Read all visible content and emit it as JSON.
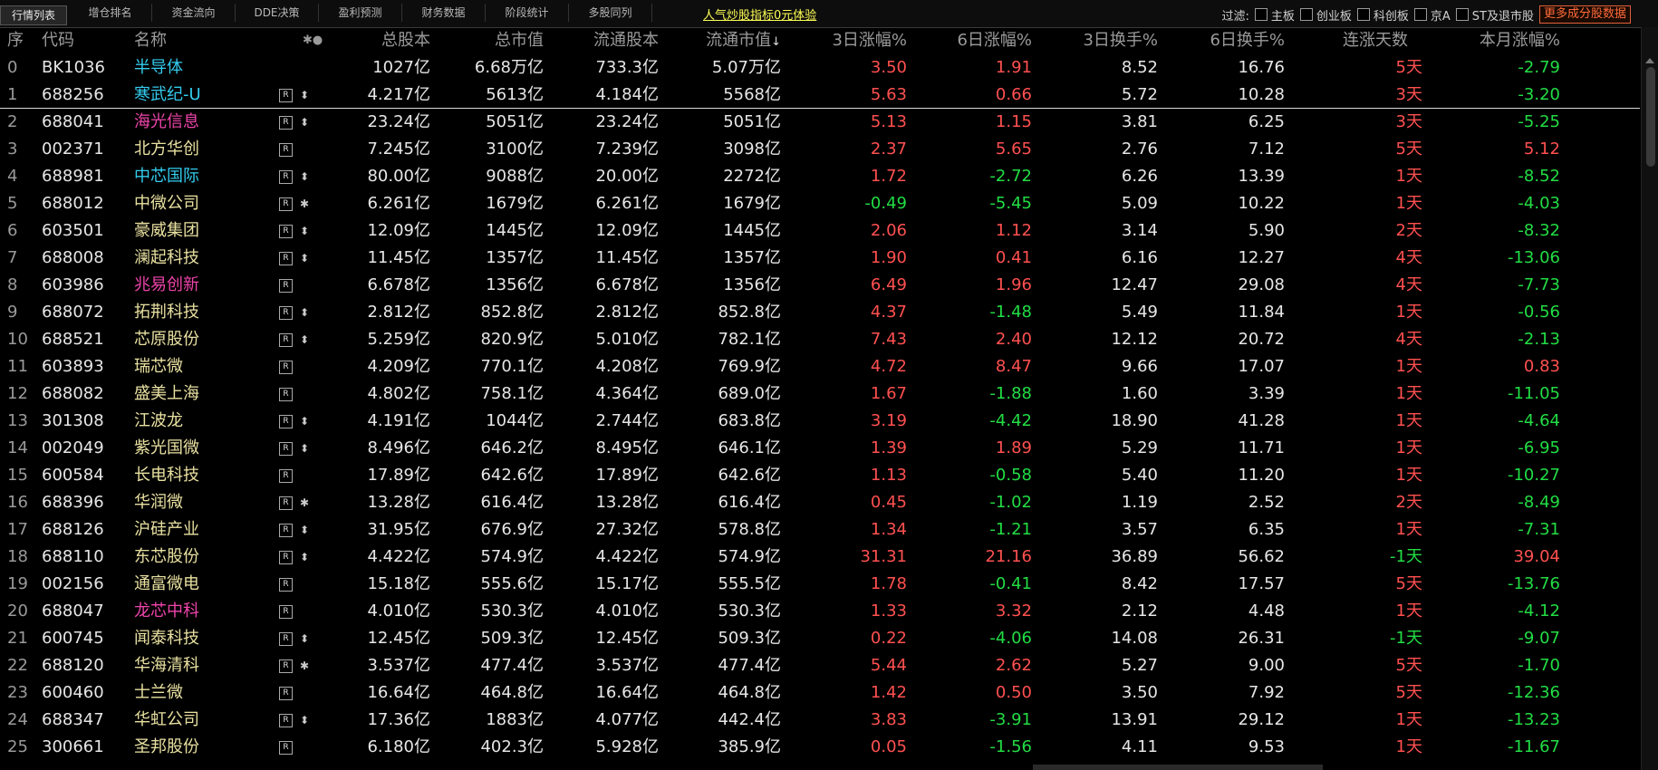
{
  "tabs": [
    "行情列表",
    "增仓排名",
    "资金流向",
    "DDE决策",
    "盈利预测",
    "财务数据",
    "阶段统计",
    "多股同列"
  ],
  "promo_text": "人气炒股指标0元体验",
  "filter": {
    "label": "过滤:",
    "options": [
      "主板",
      "创业板",
      "科创板",
      "京A",
      "ST及退市股"
    ],
    "more_label": "更多成分股数据"
  },
  "headers": {
    "idx": "序",
    "code": "代码",
    "name": "名称",
    "marks": "✱●",
    "zgb": "总股本",
    "zsz": "总市值",
    "ltgb": "流通股本",
    "ltsz": "流通市值",
    "zf3": "3日涨幅%",
    "zf6": "6日涨幅%",
    "hs3": "3日换手%",
    "hs6": "6日换手%",
    "days": "连涨天数",
    "mon": "本月涨幅%"
  },
  "colors": {
    "up": "#ff5050",
    "down": "#22dd44",
    "name_cyan": "#33ccee",
    "name_magenta": "#ee44aa",
    "name_yellow": "#e8e0a0"
  },
  "rows": [
    {
      "idx": "0",
      "code": "BK1036",
      "name": "半导体",
      "name_color": "#33ccee",
      "r": false,
      "mark": "",
      "zgb": "1027亿",
      "zsz": "6.68万亿",
      "ltgb": "733.3亿",
      "ltsz": "5.07万亿",
      "zf3": "3.50",
      "zf6": "1.91",
      "hs3": "8.52",
      "hs6": "16.76",
      "days": "5天",
      "mon": "-2.79"
    },
    {
      "idx": "1",
      "code": "688256",
      "name": "寒武纪-U",
      "name_color": "#33ccee",
      "r": true,
      "mark": "⬍",
      "zgb": "4.217亿",
      "zsz": "5613亿",
      "ltgb": "4.184亿",
      "ltsz": "5568亿",
      "zf3": "5.63",
      "zf6": "0.66",
      "hs3": "5.72",
      "hs6": "10.28",
      "days": "3天",
      "mon": "-3.20"
    },
    {
      "idx": "2",
      "code": "688041",
      "name": "海光信息",
      "name_color": "#ee44aa",
      "r": true,
      "mark": "⬍",
      "zgb": "23.24亿",
      "zsz": "5051亿",
      "ltgb": "23.24亿",
      "ltsz": "5051亿",
      "zf3": "5.13",
      "zf6": "1.15",
      "hs3": "3.81",
      "hs6": "6.25",
      "days": "3天",
      "mon": "-5.25"
    },
    {
      "idx": "3",
      "code": "002371",
      "name": "北方华创",
      "name_color": "#e8e0a0",
      "r": true,
      "mark": "",
      "zgb": "7.245亿",
      "zsz": "3100亿",
      "ltgb": "7.239亿",
      "ltsz": "3098亿",
      "zf3": "2.37",
      "zf6": "5.65",
      "hs3": "2.76",
      "hs6": "7.12",
      "days": "5天",
      "mon": "5.12"
    },
    {
      "idx": "4",
      "code": "688981",
      "name": "中芯国际",
      "name_color": "#33ccee",
      "r": true,
      "mark": "⬍",
      "zgb": "80.00亿",
      "zsz": "9088亿",
      "ltgb": "20.00亿",
      "ltsz": "2272亿",
      "zf3": "1.72",
      "zf6": "-2.72",
      "hs3": "6.26",
      "hs6": "13.39",
      "days": "1天",
      "mon": "-8.52"
    },
    {
      "idx": "5",
      "code": "688012",
      "name": "中微公司",
      "name_color": "#e8e0a0",
      "r": true,
      "mark": "✱",
      "zgb": "6.261亿",
      "zsz": "1679亿",
      "ltgb": "6.261亿",
      "ltsz": "1679亿",
      "zf3": "-0.49",
      "zf6": "-5.45",
      "hs3": "5.09",
      "hs6": "10.22",
      "days": "1天",
      "mon": "-4.03"
    },
    {
      "idx": "6",
      "code": "603501",
      "name": "豪威集团",
      "name_color": "#e8e0a0",
      "r": true,
      "mark": "⬍",
      "zgb": "12.09亿",
      "zsz": "1445亿",
      "ltgb": "12.09亿",
      "ltsz": "1445亿",
      "zf3": "2.06",
      "zf6": "1.12",
      "hs3": "3.14",
      "hs6": "5.90",
      "days": "2天",
      "mon": "-8.32"
    },
    {
      "idx": "7",
      "code": "688008",
      "name": "澜起科技",
      "name_color": "#e8e0a0",
      "r": true,
      "mark": "⬍",
      "zgb": "11.45亿",
      "zsz": "1357亿",
      "ltgb": "11.45亿",
      "ltsz": "1357亿",
      "zf3": "1.90",
      "zf6": "0.41",
      "hs3": "6.16",
      "hs6": "12.27",
      "days": "4天",
      "mon": "-13.06"
    },
    {
      "idx": "8",
      "code": "603986",
      "name": "兆易创新",
      "name_color": "#ee44aa",
      "r": true,
      "mark": "",
      "zgb": "6.678亿",
      "zsz": "1356亿",
      "ltgb": "6.678亿",
      "ltsz": "1356亿",
      "zf3": "6.49",
      "zf6": "1.96",
      "hs3": "12.47",
      "hs6": "29.08",
      "days": "4天",
      "mon": "-7.73"
    },
    {
      "idx": "9",
      "code": "688072",
      "name": "拓荆科技",
      "name_color": "#e8e0a0",
      "r": true,
      "mark": "⬍",
      "zgb": "2.812亿",
      "zsz": "852.8亿",
      "ltgb": "2.812亿",
      "ltsz": "852.8亿",
      "zf3": "4.37",
      "zf6": "-1.48",
      "hs3": "5.49",
      "hs6": "11.84",
      "days": "1天",
      "mon": "-0.56"
    },
    {
      "idx": "10",
      "code": "688521",
      "name": "芯原股份",
      "name_color": "#e8e0a0",
      "r": true,
      "mark": "⬍",
      "zgb": "5.259亿",
      "zsz": "820.9亿",
      "ltgb": "5.010亿",
      "ltsz": "782.1亿",
      "zf3": "7.43",
      "zf6": "2.40",
      "hs3": "12.12",
      "hs6": "20.72",
      "days": "4天",
      "mon": "-2.13"
    },
    {
      "idx": "11",
      "code": "603893",
      "name": "瑞芯微",
      "name_color": "#e8e0a0",
      "r": true,
      "mark": "",
      "zgb": "4.209亿",
      "zsz": "770.1亿",
      "ltgb": "4.208亿",
      "ltsz": "769.9亿",
      "zf3": "4.72",
      "zf6": "8.47",
      "hs3": "9.66",
      "hs6": "17.07",
      "days": "1天",
      "mon": "0.83"
    },
    {
      "idx": "12",
      "code": "688082",
      "name": "盛美上海",
      "name_color": "#e8e0a0",
      "r": true,
      "mark": "",
      "zgb": "4.802亿",
      "zsz": "758.1亿",
      "ltgb": "4.364亿",
      "ltsz": "689.0亿",
      "zf3": "1.67",
      "zf6": "-1.88",
      "hs3": "1.60",
      "hs6": "3.39",
      "days": "1天",
      "mon": "-11.05"
    },
    {
      "idx": "13",
      "code": "301308",
      "name": "江波龙",
      "name_color": "#e8e0a0",
      "r": true,
      "mark": "⬍",
      "zgb": "4.191亿",
      "zsz": "1044亿",
      "ltgb": "2.744亿",
      "ltsz": "683.8亿",
      "zf3": "3.19",
      "zf6": "-4.42",
      "hs3": "18.90",
      "hs6": "41.28",
      "days": "1天",
      "mon": "-4.64"
    },
    {
      "idx": "14",
      "code": "002049",
      "name": "紫光国微",
      "name_color": "#e8e0a0",
      "r": true,
      "mark": "⬍",
      "zgb": "8.496亿",
      "zsz": "646.2亿",
      "ltgb": "8.495亿",
      "ltsz": "646.1亿",
      "zf3": "1.39",
      "zf6": "1.89",
      "hs3": "5.29",
      "hs6": "11.71",
      "days": "1天",
      "mon": "-6.95"
    },
    {
      "idx": "15",
      "code": "600584",
      "name": "长电科技",
      "name_color": "#e8e0a0",
      "r": true,
      "mark": "",
      "zgb": "17.89亿",
      "zsz": "642.6亿",
      "ltgb": "17.89亿",
      "ltsz": "642.6亿",
      "zf3": "1.13",
      "zf6": "-0.58",
      "hs3": "5.40",
      "hs6": "11.20",
      "days": "1天",
      "mon": "-10.27"
    },
    {
      "idx": "16",
      "code": "688396",
      "name": "华润微",
      "name_color": "#e8e0a0",
      "r": true,
      "mark": "✱",
      "zgb": "13.28亿",
      "zsz": "616.4亿",
      "ltgb": "13.28亿",
      "ltsz": "616.4亿",
      "zf3": "0.45",
      "zf6": "-1.02",
      "hs3": "1.19",
      "hs6": "2.52",
      "days": "2天",
      "mon": "-8.49"
    },
    {
      "idx": "17",
      "code": "688126",
      "name": "沪硅产业",
      "name_color": "#e8e0a0",
      "r": true,
      "mark": "⬍",
      "zgb": "31.95亿",
      "zsz": "676.9亿",
      "ltgb": "27.32亿",
      "ltsz": "578.8亿",
      "zf3": "1.34",
      "zf6": "-1.21",
      "hs3": "3.57",
      "hs6": "6.35",
      "days": "1天",
      "mon": "-7.31"
    },
    {
      "idx": "18",
      "code": "688110",
      "name": "东芯股份",
      "name_color": "#e8e0a0",
      "r": true,
      "mark": "⬍",
      "zgb": "4.422亿",
      "zsz": "574.9亿",
      "ltgb": "4.422亿",
      "ltsz": "574.9亿",
      "zf3": "31.31",
      "zf6": "21.16",
      "hs3": "36.89",
      "hs6": "56.62",
      "days": "-1天",
      "mon": "39.04"
    },
    {
      "idx": "19",
      "code": "002156",
      "name": "通富微电",
      "name_color": "#e8e0a0",
      "r": true,
      "mark": "",
      "zgb": "15.18亿",
      "zsz": "555.6亿",
      "ltgb": "15.17亿",
      "ltsz": "555.5亿",
      "zf3": "1.78",
      "zf6": "-0.41",
      "hs3": "8.42",
      "hs6": "17.57",
      "days": "5天",
      "mon": "-13.76"
    },
    {
      "idx": "20",
      "code": "688047",
      "name": "龙芯中科",
      "name_color": "#ee44aa",
      "r": true,
      "mark": "",
      "zgb": "4.010亿",
      "zsz": "530.3亿",
      "ltgb": "4.010亿",
      "ltsz": "530.3亿",
      "zf3": "1.33",
      "zf6": "3.32",
      "hs3": "2.12",
      "hs6": "4.48",
      "days": "1天",
      "mon": "-4.12"
    },
    {
      "idx": "21",
      "code": "600745",
      "name": "闻泰科技",
      "name_color": "#e8e0a0",
      "r": true,
      "mark": "⬍",
      "zgb": "12.45亿",
      "zsz": "509.3亿",
      "ltgb": "12.45亿",
      "ltsz": "509.3亿",
      "zf3": "0.22",
      "zf6": "-4.06",
      "hs3": "14.08",
      "hs6": "26.31",
      "days": "-1天",
      "mon": "-9.07"
    },
    {
      "idx": "22",
      "code": "688120",
      "name": "华海清科",
      "name_color": "#e8e0a0",
      "r": true,
      "mark": "✱",
      "zgb": "3.537亿",
      "zsz": "477.4亿",
      "ltgb": "3.537亿",
      "ltsz": "477.4亿",
      "zf3": "5.44",
      "zf6": "2.62",
      "hs3": "5.27",
      "hs6": "9.00",
      "days": "5天",
      "mon": "-1.70"
    },
    {
      "idx": "23",
      "code": "600460",
      "name": "士兰微",
      "name_color": "#e8e0a0",
      "r": true,
      "mark": "",
      "zgb": "16.64亿",
      "zsz": "464.8亿",
      "ltgb": "16.64亿",
      "ltsz": "464.8亿",
      "zf3": "1.42",
      "zf6": "0.50",
      "hs3": "3.50",
      "hs6": "7.92",
      "days": "5天",
      "mon": "-12.36"
    },
    {
      "idx": "24",
      "code": "688347",
      "name": "华虹公司",
      "name_color": "#e8e0a0",
      "r": true,
      "mark": "⬍",
      "zgb": "17.36亿",
      "zsz": "1883亿",
      "ltgb": "4.077亿",
      "ltsz": "442.4亿",
      "zf3": "3.83",
      "zf6": "-3.91",
      "hs3": "13.91",
      "hs6": "29.12",
      "days": "1天",
      "mon": "-13.23"
    },
    {
      "idx": "25",
      "code": "300661",
      "name": "圣邦股份",
      "name_color": "#e8e0a0",
      "r": true,
      "mark": "",
      "zgb": "6.180亿",
      "zsz": "402.3亿",
      "ltgb": "5.928亿",
      "ltsz": "385.9亿",
      "zf3": "0.05",
      "zf6": "-1.56",
      "hs3": "4.11",
      "hs6": "9.53",
      "days": "1天",
      "mon": "-11.67"
    }
  ]
}
